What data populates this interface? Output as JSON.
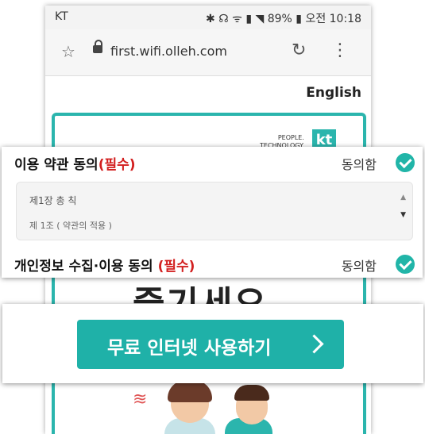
{
  "status_bar": {
    "carrier": "KT",
    "icons_text": "✱ ☊ ᯤ ▮ ◥",
    "battery": "89%",
    "time": "오전 10:18"
  },
  "browser": {
    "url": "first.wifi.olleh.com",
    "star_icon": "star-icon",
    "lock_icon": "lock-icon",
    "reload_icon": "reload-icon",
    "menu_icon": "more-vert-icon"
  },
  "page": {
    "english_link": "English",
    "kt_tagline_1": "PEOPLE.",
    "kt_tagline_2": "TECHNOLOGY.",
    "kt_logo": "kt",
    "big_text": "즐기세요"
  },
  "terms": {
    "title": "이용 약관 동의",
    "required": "(필수)",
    "agree_label": "동의함",
    "box_line1": "제1장 총 칙",
    "box_line2": "제 1조 ( 약관의 적용 )"
  },
  "privacy": {
    "title": "개인정보 수집·이용 동의",
    "required": "(필수)",
    "agree_label": "동의함"
  },
  "cta": {
    "label": "무료 인터넷 사용하기"
  },
  "colors": {
    "accent": "#1fb1a8",
    "required_red": "#d21f1f"
  }
}
